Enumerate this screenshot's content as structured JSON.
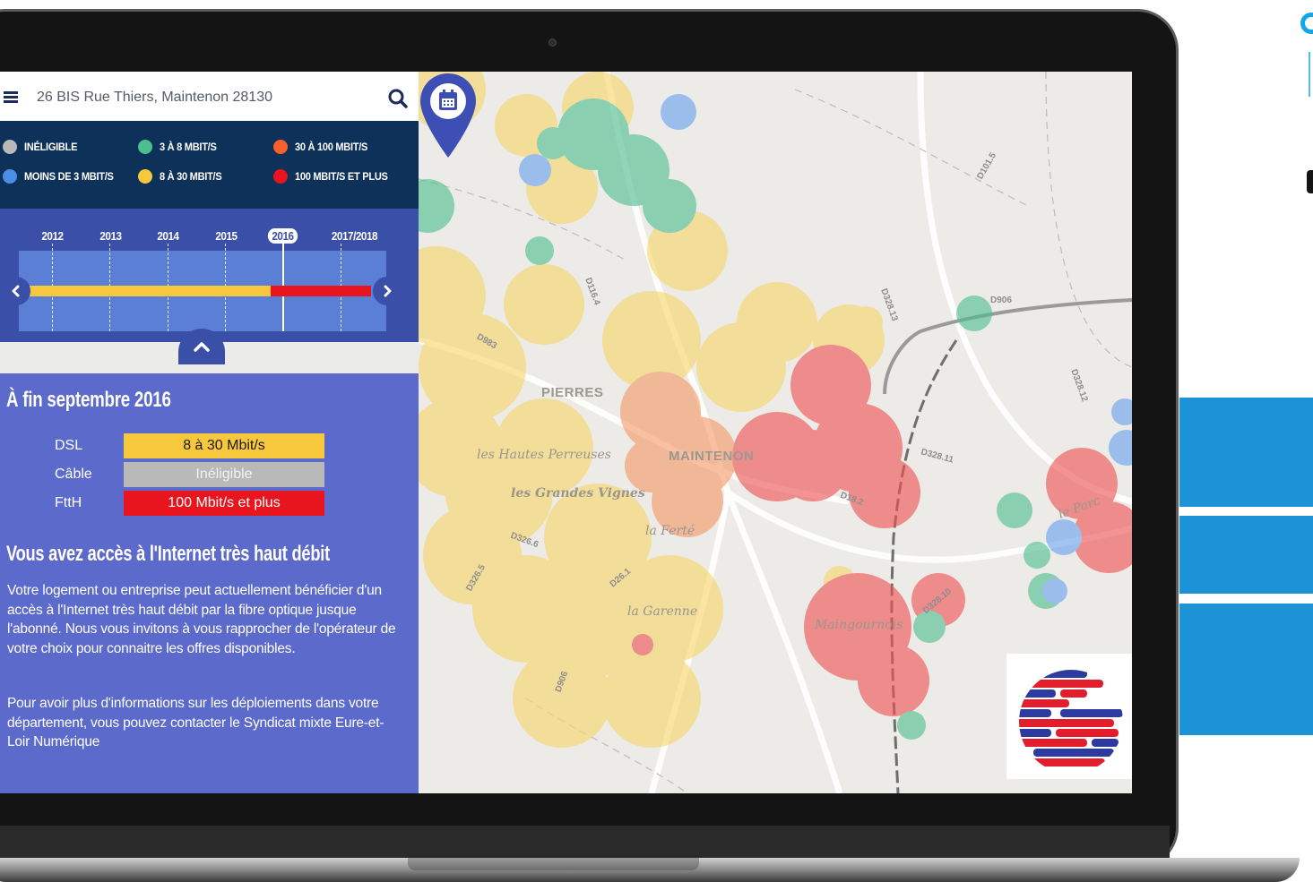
{
  "search": {
    "address": "26 BIS Rue Thiers, Maintenon 28130"
  },
  "legend": {
    "items": [
      {
        "label": "Inéligible",
        "color": "#b9b9b9"
      },
      {
        "label": "Moins de 3 Mbit/s",
        "color": "#4b8ee8"
      },
      {
        "label": "3 à 8 Mbit/s",
        "color": "#4dbf8f"
      },
      {
        "label": "8 à 30 Mbit/s",
        "color": "#f7c73c"
      },
      {
        "label": "30 à 100 Mbit/s",
        "color": "#f7602a"
      },
      {
        "label": "100 Mbit/s et plus",
        "color": "#e8151f"
      }
    ]
  },
  "timeline": {
    "years": [
      "2012",
      "2013",
      "2014",
      "2015",
      "2016",
      "2017/2018"
    ],
    "selected_year": "2016"
  },
  "info": {
    "title": "À fin septembre 2016",
    "technologies": [
      {
        "name": "DSL",
        "value": "8 à 30 Mbit/s",
        "color": "#f7c73c",
        "text_color": "#1b1b1b"
      },
      {
        "name": "Câble",
        "value": "Inéligible",
        "color": "#b9b9b9",
        "text_color": "#f2f2f2"
      },
      {
        "name": "FttH",
        "value": "100 Mbit/s et plus",
        "color": "#e8151f",
        "text_color": "#ffffff"
      }
    ],
    "headline": "Vous avez accès à l'Internet très haut débit",
    "paragraph1": "Votre logement ou entreprise peut actuellement bénéficier d'un accès à l'Internet très haut débit par la fibre optique jusque l'abonné. Nous vous invitons à vous rapprocher de l'opérateur de votre choix pour connaitre les offres disponibles.",
    "paragraph2": "Pour avoir plus d'informations sur les déploiements dans votre département, vous pouvez contacter le Syndicat mixte Eure-et-Loir Numérique"
  },
  "map": {
    "places": [
      "PIERRES",
      "MAINTENON",
      "les Hautes Perreuses",
      "les Grandes Vignes",
      "la Ferté",
      "la Garenne",
      "Maingournois",
      "le Parc"
    ],
    "roads": [
      "D101.5",
      "D116.4",
      "D983",
      "D328.13",
      "D906",
      "D328.12",
      "D328.11",
      "D18.2",
      "D326.6",
      "D326.5",
      "D26.1",
      "D328.10",
      "D906"
    ]
  }
}
